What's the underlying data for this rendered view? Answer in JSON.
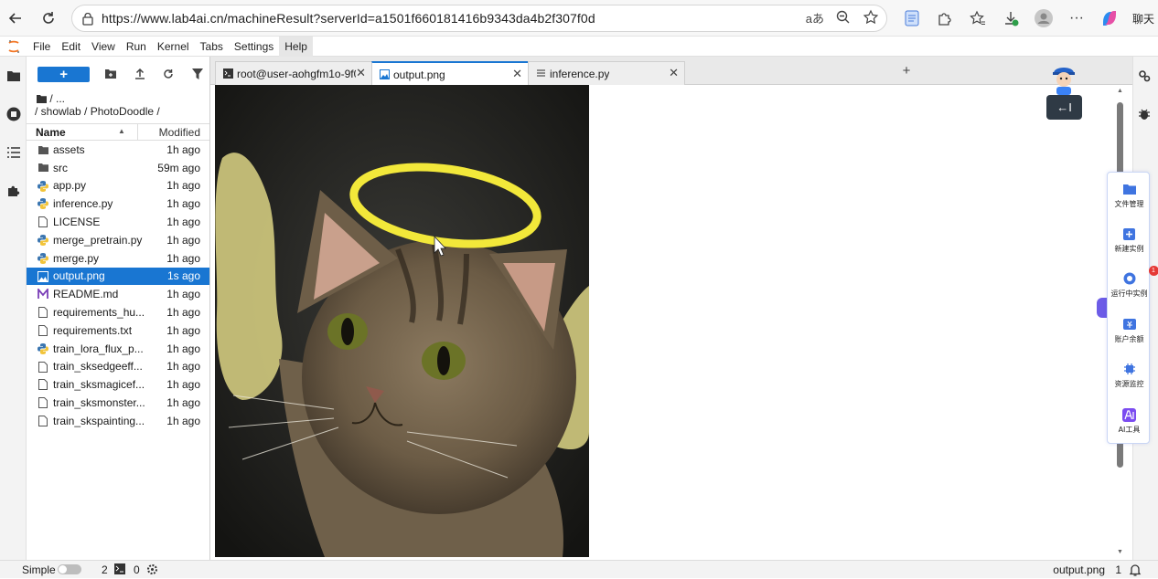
{
  "browser": {
    "url": "https://www.lab4ai.cn/machineResult?serverId=a1501f660181416b9343da4b2f307f0d",
    "chat_label": "聊天"
  },
  "menu": {
    "items": [
      "File",
      "Edit",
      "View",
      "Run",
      "Kernel",
      "Tabs",
      "Settings",
      "Help"
    ]
  },
  "filebrowser": {
    "new_label": "+",
    "crumb_top": "/ ...",
    "crumb_path": "/ showlab / PhotoDoodle /",
    "col_name": "Name",
    "col_modified": "Modified",
    "files": [
      {
        "name": "assets",
        "time": "1h ago",
        "type": "folder"
      },
      {
        "name": "src",
        "time": "59m ago",
        "type": "folder"
      },
      {
        "name": "app.py",
        "time": "1h ago",
        "type": "python"
      },
      {
        "name": "inference.py",
        "time": "1h ago",
        "type": "python"
      },
      {
        "name": "LICENSE",
        "time": "1h ago",
        "type": "file"
      },
      {
        "name": "merge_pretrain.py",
        "time": "1h ago",
        "type": "python"
      },
      {
        "name": "merge.py",
        "time": "1h ago",
        "type": "python"
      },
      {
        "name": "output.png",
        "time": "1s ago",
        "type": "image"
      },
      {
        "name": "README.md",
        "time": "1h ago",
        "type": "markdown"
      },
      {
        "name": "requirements_hu...",
        "time": "1h ago",
        "type": "file"
      },
      {
        "name": "requirements.txt",
        "time": "1h ago",
        "type": "file"
      },
      {
        "name": "train_lora_flux_p...",
        "time": "1h ago",
        "type": "python"
      },
      {
        "name": "train_sksedgeeff...",
        "time": "1h ago",
        "type": "file"
      },
      {
        "name": "train_sksmagicef...",
        "time": "1h ago",
        "type": "file"
      },
      {
        "name": "train_sksmonster...",
        "time": "1h ago",
        "type": "file"
      },
      {
        "name": "train_skspainting...",
        "time": "1h ago",
        "type": "file"
      }
    ]
  },
  "tabs": {
    "terminal": "root@user-aohgfm1o-9f0`",
    "image": "output.png",
    "code": "inference.py",
    "add": "+"
  },
  "floatpanel": {
    "tooltip": "←I",
    "badge": "1",
    "items": [
      "文件管理",
      "新建实例",
      "运行中实例",
      "账户余额",
      "资源监控",
      "AI工具"
    ]
  },
  "status": {
    "mode": "Simple",
    "terminals": "2",
    "kernels": "0",
    "current_file": "output.png",
    "notifications": "1"
  },
  "colors": {
    "accent": "#1976d2",
    "halo": "#f2e83a",
    "wings": "#c9c27a"
  }
}
